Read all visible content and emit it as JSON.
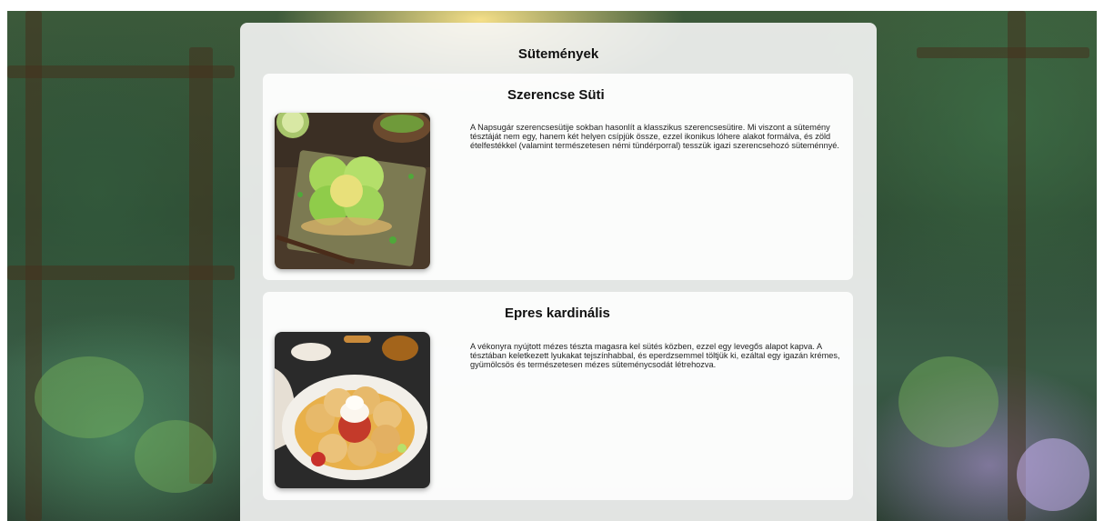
{
  "page": {
    "heading": "Sütemények"
  },
  "items": [
    {
      "title": "Szerencse Süti",
      "description": "A Napsugár szerencsesütije sokban hasonlít a klasszikus szerencsesütire. Mi viszont a sütemény tésztáját nem egy, hanem két helyen csípjük össze, ezzel ikonikus lóhere alakot formálva, és zöld ételfestékkel (valamint természetesen némi tündérporral) tesszük igazi szerencsehozó süteménnyé.",
      "image_icon": "four-leaf-clover-cookie"
    },
    {
      "title": "Epres kardinális",
      "description": "A vékonyra nyújtott mézes tészta magasra kel sütés közben, ezzel egy levegős alapot kapva. A tésztában keletkezett lyukakat tejszínhabbal, és eperdzsemmel töltjük ki, ezáltal egy igazán krémes, gyümölcsös és természetesen mézes süteménycsodát létrehozva.",
      "image_icon": "strawberry-cream-pastry"
    }
  ]
}
